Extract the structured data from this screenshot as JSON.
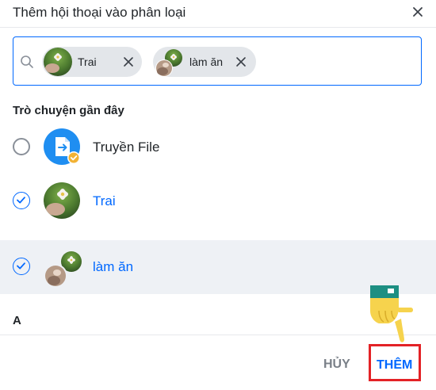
{
  "dialog": {
    "title": "Thêm hội thoại vào phân loại"
  },
  "search": {
    "chips": [
      {
        "label": "Trai"
      },
      {
        "label": "làm ăn"
      }
    ]
  },
  "recent": {
    "section_title": "Trò chuyện gần đây",
    "items": [
      {
        "label": "Truyền File",
        "checked": false,
        "icon": "file-transfer-icon"
      },
      {
        "label": "Trai",
        "checked": true,
        "icon": "avatar-flower"
      },
      {
        "label": "làm ăn",
        "checked": true,
        "icon": "group-avatar"
      }
    ]
  },
  "alpha_section": {
    "letter": "A"
  },
  "footer": {
    "cancel_label": "HỦY",
    "add_label": "THÊM"
  },
  "colors": {
    "accent": "#0068ff",
    "highlight_border": "#e32226",
    "selected_row_bg": "#eef1f5"
  }
}
